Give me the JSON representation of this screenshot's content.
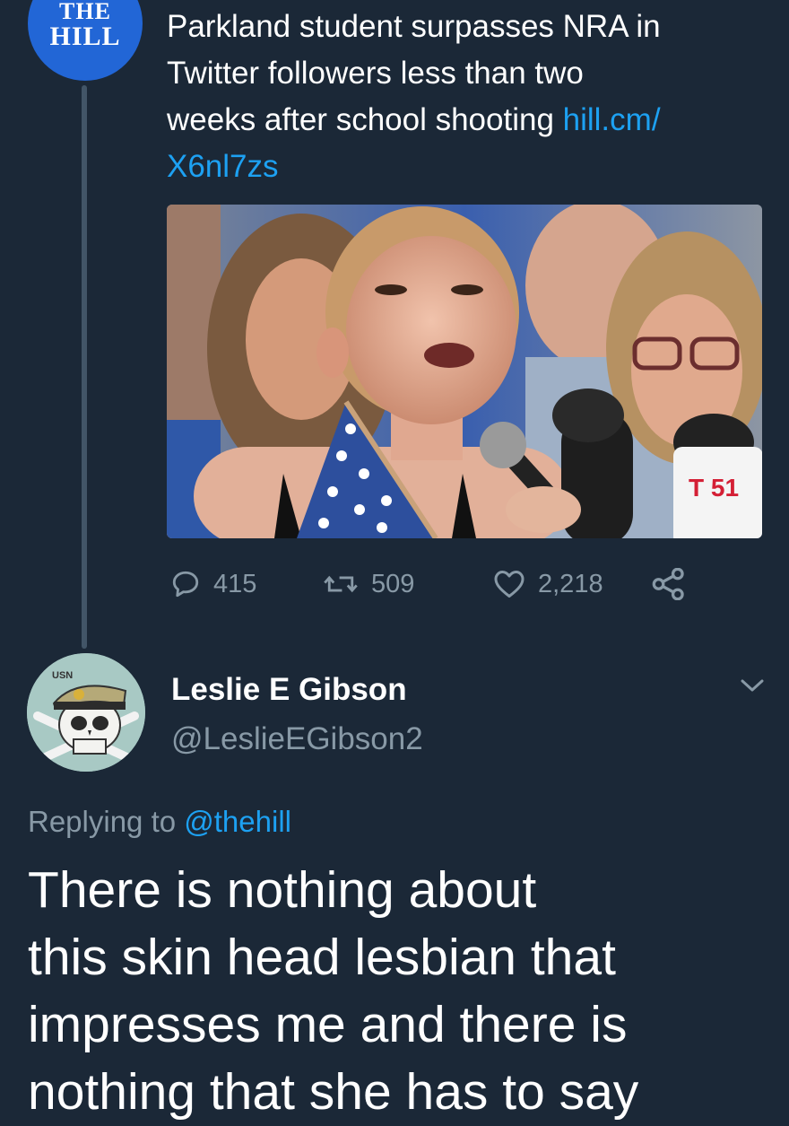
{
  "source_tweet": {
    "avatar_logo": [
      "THE",
      "HILL"
    ],
    "text": "Parkland student surpasses NRA in Twitter followers less than two weeks after school shooting ",
    "link": "hill.cm/X6nl7zs",
    "link_line1": "hill.cm/",
    "link_line2": "X6nl7zs",
    "text_lines": [
      "Parkland student surpasses NRA in",
      "Twitter followers less than two",
      "weeks after school shooting "
    ],
    "photo": {
      "station_logo": "T 51"
    },
    "counts": {
      "replies": "415",
      "retweets": "509",
      "likes": "2,218"
    }
  },
  "reply_tweet": {
    "avatar_badge": "USN",
    "name": "Leslie E Gibson",
    "handle": "@LeslieEGibson2",
    "replying_prefix": "Replying to ",
    "replying_to": "@thehill",
    "text_lines": [
      "There is nothing about",
      "this skin head lesbian that",
      "impresses me and there is",
      "nothing that she has to say"
    ]
  },
  "colors": {
    "background": "#1b2837",
    "link": "#1da1f2",
    "muted": "#8899a6",
    "brand_avatar": "#2266d6"
  },
  "icons": [
    "reply-icon",
    "retweet-icon",
    "like-icon",
    "share-icon",
    "chevron-down-icon"
  ]
}
